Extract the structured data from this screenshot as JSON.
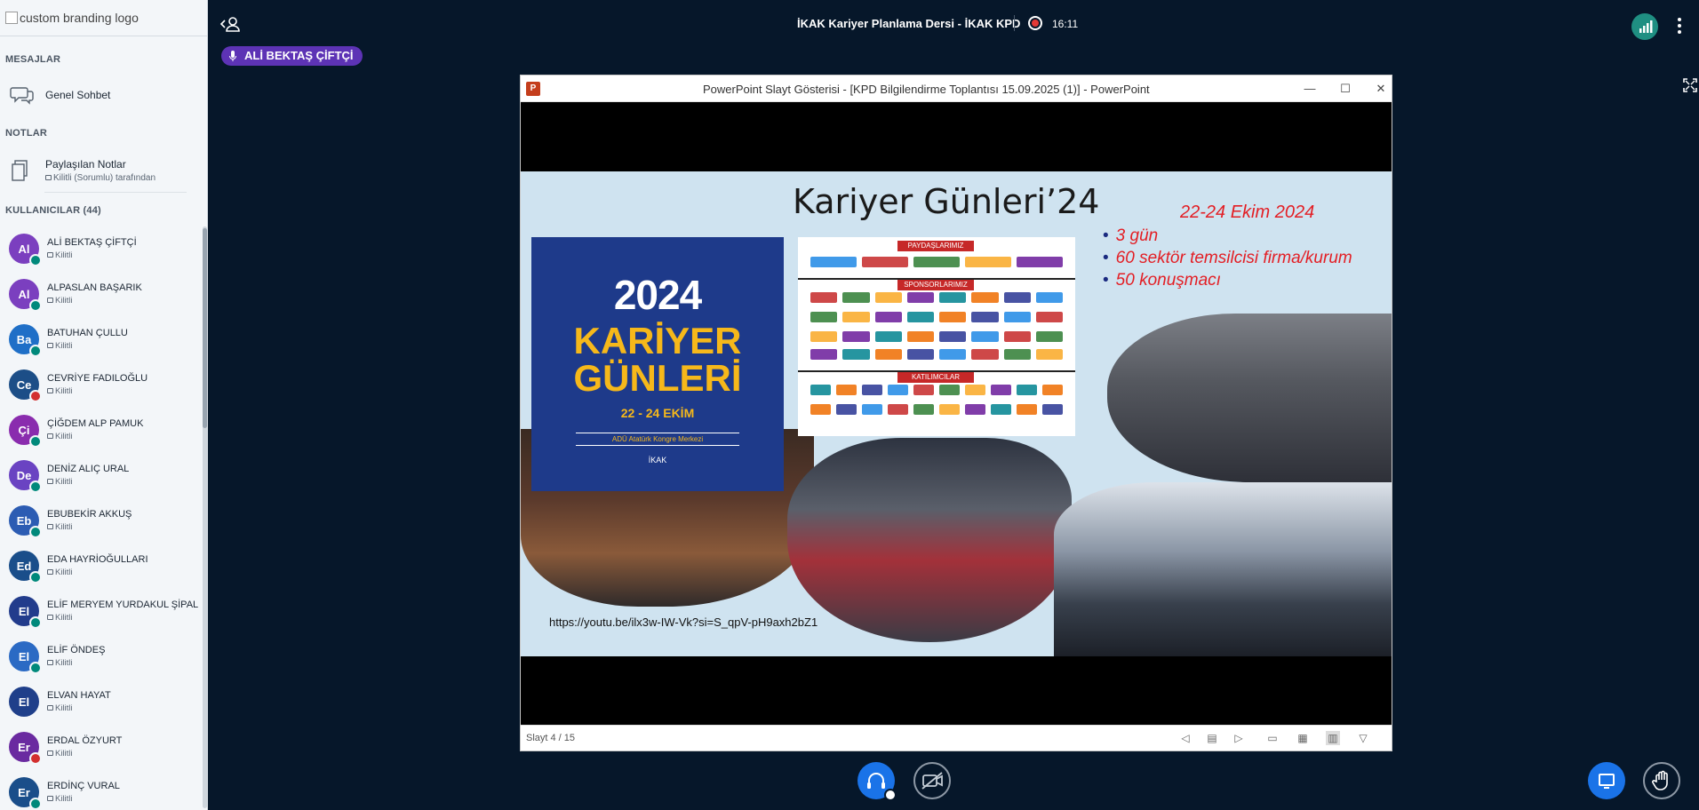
{
  "sidebar": {
    "branding_alt": "custom branding logo",
    "messages_title": "MESAJLAR",
    "public_chat_label": "Genel Sohbet",
    "notes_title": "NOTLAR",
    "shared_notes_label": "Paylaşılan Notlar",
    "shared_notes_status": "Kilitli (Sorumlu) tarafından",
    "users_title": "KULLANICILAR (44)",
    "users": [
      {
        "initials": "Al",
        "name": "ALİ BEKTAŞ ÇİFTÇİ",
        "status": "Kilitli",
        "color": "#7b3fbf",
        "mic": "on"
      },
      {
        "initials": "Al",
        "name": "ALPASLAN BAŞARIK",
        "status": "Kilitli",
        "color": "#7b3fbf",
        "mic": "on"
      },
      {
        "initials": "Ba",
        "name": "BATUHAN ÇULLU",
        "status": "Kilitli",
        "color": "#1f6fc7",
        "mic": "on"
      },
      {
        "initials": "Ce",
        "name": "CEVRİYE FADILOĞLU",
        "status": "Kilitli",
        "color": "#1c4e87",
        "mic": "off"
      },
      {
        "initials": "Çi",
        "name": "ÇİĞDEM ALP PAMUK",
        "status": "Kilitli",
        "color": "#8a2cae",
        "mic": "on"
      },
      {
        "initials": "De",
        "name": "DENİZ ALIÇ URAL",
        "status": "Kilitli",
        "color": "#6a43c2",
        "mic": "on"
      },
      {
        "initials": "Eb",
        "name": "EBUBEKİR AKKUŞ",
        "status": "Kilitli",
        "color": "#2c5cb3",
        "mic": "on"
      },
      {
        "initials": "Ed",
        "name": "EDA HAYRİOĞULLARI",
        "status": "Kilitli",
        "color": "#1a4e8a",
        "mic": "on"
      },
      {
        "initials": "El",
        "name": "ELİF MERYEM YURDAKUL ŞİPAL",
        "status": "Kilitli",
        "color": "#223c8c",
        "mic": "on"
      },
      {
        "initials": "El",
        "name": "ELİF ÖNDEŞ",
        "status": "Kilitli",
        "color": "#2b6ac4",
        "mic": "on"
      },
      {
        "initials": "El",
        "name": "ELVAN HAYAT",
        "status": "Kilitli",
        "color": "#1f3f8a",
        "mic": "none"
      },
      {
        "initials": "Er",
        "name": "ERDAL ÖZYURT",
        "status": "Kilitli",
        "color": "#6a2aa0",
        "mic": "off"
      },
      {
        "initials": "Er",
        "name": "ERDİNÇ VURAL",
        "status": "Kilitli",
        "color": "#1a4e8a",
        "mic": "on"
      }
    ]
  },
  "topbar": {
    "meeting_title": "İKAK Kariyer Planlama Dersi - İKAK KPD",
    "timer": "16:11",
    "talking_user": "ALİ BEKTAŞ ÇİFTÇİ"
  },
  "presentation": {
    "window_title": "PowerPoint Slayt Gösterisi - [KPD Bilgilendirme Toplantısı 15.09.2025 (1)] - PowerPoint",
    "slide_counter": "Slayt 4 / 15",
    "slide": {
      "title": "Kariyer Günleri’24",
      "date": "22-24 Ekim 2024",
      "bullets": [
        "3 gün",
        "60 sektör temsilcisi firma/kurum",
        "50 konuşmacı"
      ],
      "url": "https://youtu.be/ilx3w-IW-Vk?si=S_qpV-pH9axh2bZ1",
      "poster": {
        "year": "2024",
        "line1": "KARİYER",
        "line2": "GÜNLERİ",
        "dates": "22 - 24 EKİM",
        "location": "ADÜ Atatürk Kongre Merkezi",
        "organizer": "İKAK"
      },
      "logo_sections": [
        "PAYDAŞLARIMIZ",
        "SPONSORLARIMIZ",
        "KATILIMCILAR"
      ]
    }
  },
  "colors": {
    "accent": "#1a73e8",
    "talker_badge": "#5d33b5",
    "slide_red": "#e31e24"
  }
}
